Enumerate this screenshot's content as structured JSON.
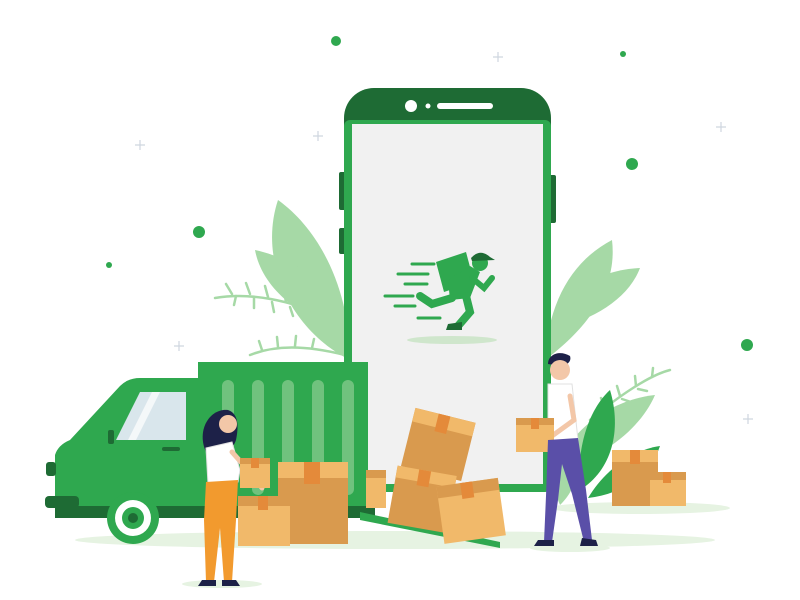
{
  "illustration": {
    "subject": "delivery",
    "icons": [
      "courier-runner-icon",
      "delivery-truck-icon",
      "cardboard-box-icon",
      "smartphone-icon",
      "leaf-icon"
    ]
  },
  "palette": {
    "brand_green": "#2fa84f",
    "dark_green": "#1e6b34",
    "light_green": "#a6d9a6",
    "pale_green": "#e6f3e2",
    "screen": "#f1f1f1",
    "box": "#f1b96a",
    "box_shade": "#d99a4e",
    "tape": "#e48a3a",
    "woman_pants": "#f29a2e",
    "man_pants": "#5a4fa8",
    "hair": "#1d2148",
    "skin": "#f3c7a8"
  }
}
